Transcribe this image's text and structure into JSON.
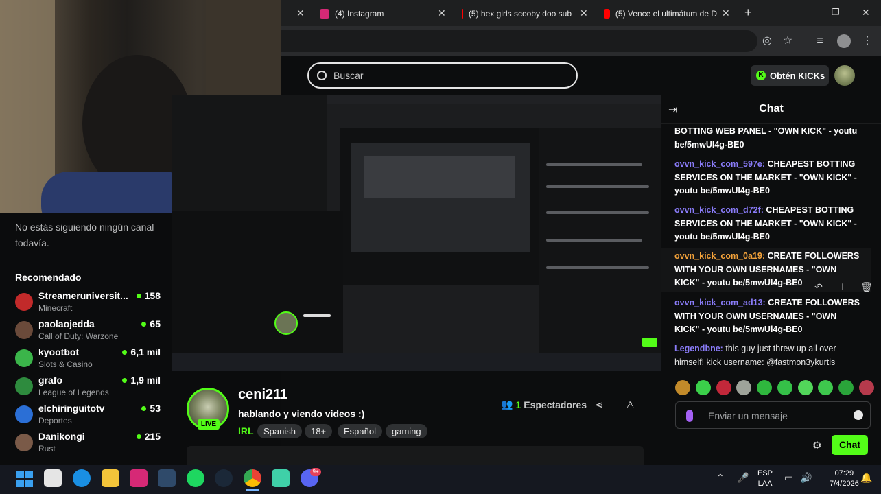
{
  "browser": {
    "tabs": [
      {
        "label": "(4) Instagram",
        "color": "#d62976"
      },
      {
        "label": "(5) hex girls scooby doo sub",
        "color": "#ff0000"
      },
      {
        "label": "(5) Vence el ultimátum de D",
        "color": "#ff0000"
      }
    ],
    "new_tab": "+",
    "window_controls": {
      "minimize": "—",
      "maximize": "❐",
      "close": "✕"
    }
  },
  "header": {
    "search_placeholder": "Buscar",
    "kicks_button": "Obtén KICKs"
  },
  "sidebar": {
    "following_empty": "No estás siguiendo ningún canal todavía.",
    "recommended_title": "Recomendado",
    "items": [
      {
        "name": "Streameruniversit...",
        "category": "Minecraft",
        "viewers": "158",
        "color": "#c22a2a"
      },
      {
        "name": "paolaojedda",
        "category": "Call of Duty: Warzone",
        "viewers": "65",
        "color": "#6a4a3a"
      },
      {
        "name": "kyootbot",
        "category": "Slots & Casino",
        "viewers": "6,1 mil",
        "color": "#3bb54a"
      },
      {
        "name": "grafo",
        "category": "League of Legends",
        "viewers": "1,9 mil",
        "color": "#2e8b3e"
      },
      {
        "name": "elchiringuitotv",
        "category": "Deportes",
        "viewers": "53",
        "color": "#2b6fd6"
      },
      {
        "name": "Danikongi",
        "category": "Rust",
        "viewers": "215",
        "color": "#7a5a48"
      }
    ]
  },
  "stream": {
    "streamer": "ceni211",
    "live_badge": "LIVE",
    "title": "hablando y viendo videos :)",
    "category": "IRL",
    "tags": [
      "Spanish",
      "18+",
      "Español",
      "gaming"
    ],
    "viewers_count": "1",
    "viewers_label": "Espectadores"
  },
  "chat": {
    "title": "Chat",
    "messages": [
      {
        "user": "",
        "text": "BOTTING WEB PANEL - \"OWN KICK\" - youtu be/5mwUl4g-BE0"
      },
      {
        "user": "ovvn_kick_com_597e:",
        "text": " CHEAPEST BOTTING SERVICES ON THE MARKET - \"OWN KICK\" - youtu be/5mwUl4g-BE0"
      },
      {
        "user": "ovvn_kick_com_d72f:",
        "text": " CHEAPEST BOTTING SERVICES ON THE MARKET - \"OWN KICK\" - youtu be/5mwUl4g-BE0"
      },
      {
        "user": "ovvn_kick_com_0a19:",
        "text": " CREATE FOLLOWERS WITH YOUR OWN USERNAMES - \"OWN KICK\" - youtu be/5mwUl4g-BE0"
      },
      {
        "user": "ovvn_kick_com_ad13:",
        "text": " CREATE FOLLOWERS WITH YOUR OWN USERNAMES - \"OWN KICK\" - youtu be/5mwUl4g-BE0"
      },
      {
        "user": "Legendbne:",
        "text": " this guy just threw up all over himself! kick username: @fastmon3ykurtis"
      }
    ],
    "input_placeholder": "Enviar un mensaje",
    "send_button": "Chat"
  },
  "taskbar": {
    "lang_top": "ESP",
    "lang_bottom": "LAA",
    "time": "07:29",
    "date": "7/4/2026",
    "discord_badge": "9+"
  },
  "colors": {
    "accent": "#53fc18",
    "username": "#8a7cf9",
    "username_highlight": "#f3a23a"
  }
}
